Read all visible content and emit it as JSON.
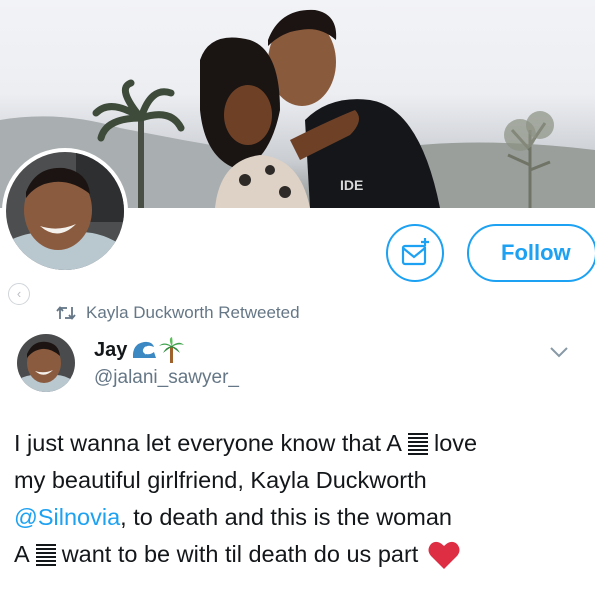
{
  "profile": {
    "follow_label": "Follow"
  },
  "retweet": {
    "context_text": "Kayla Duckworth Retweeted"
  },
  "tweet": {
    "display_name": "Jay",
    "handle": "@jalani_sawyer_",
    "name_emojis": [
      "water-wave-icon",
      "palm-tree-icon"
    ],
    "body": {
      "line1_before": "I just wanna let everyone know that A",
      "line1_after": "love",
      "line2": "my beautiful girlfriend, Kayla Duckworth",
      "line3_mention": "@Silnovia",
      "line3_rest": ", to death and this is the woman",
      "line4_before": "A",
      "line4_after": "want to be with til death do us part"
    },
    "inline_icons": [
      "barcode-glyph-icon",
      "barcode-glyph-icon",
      "red-heart-icon"
    ]
  },
  "colors": {
    "accent": "#1da1f2",
    "text": "#14171a",
    "secondary": "#657786",
    "heart": "#e0245e"
  }
}
